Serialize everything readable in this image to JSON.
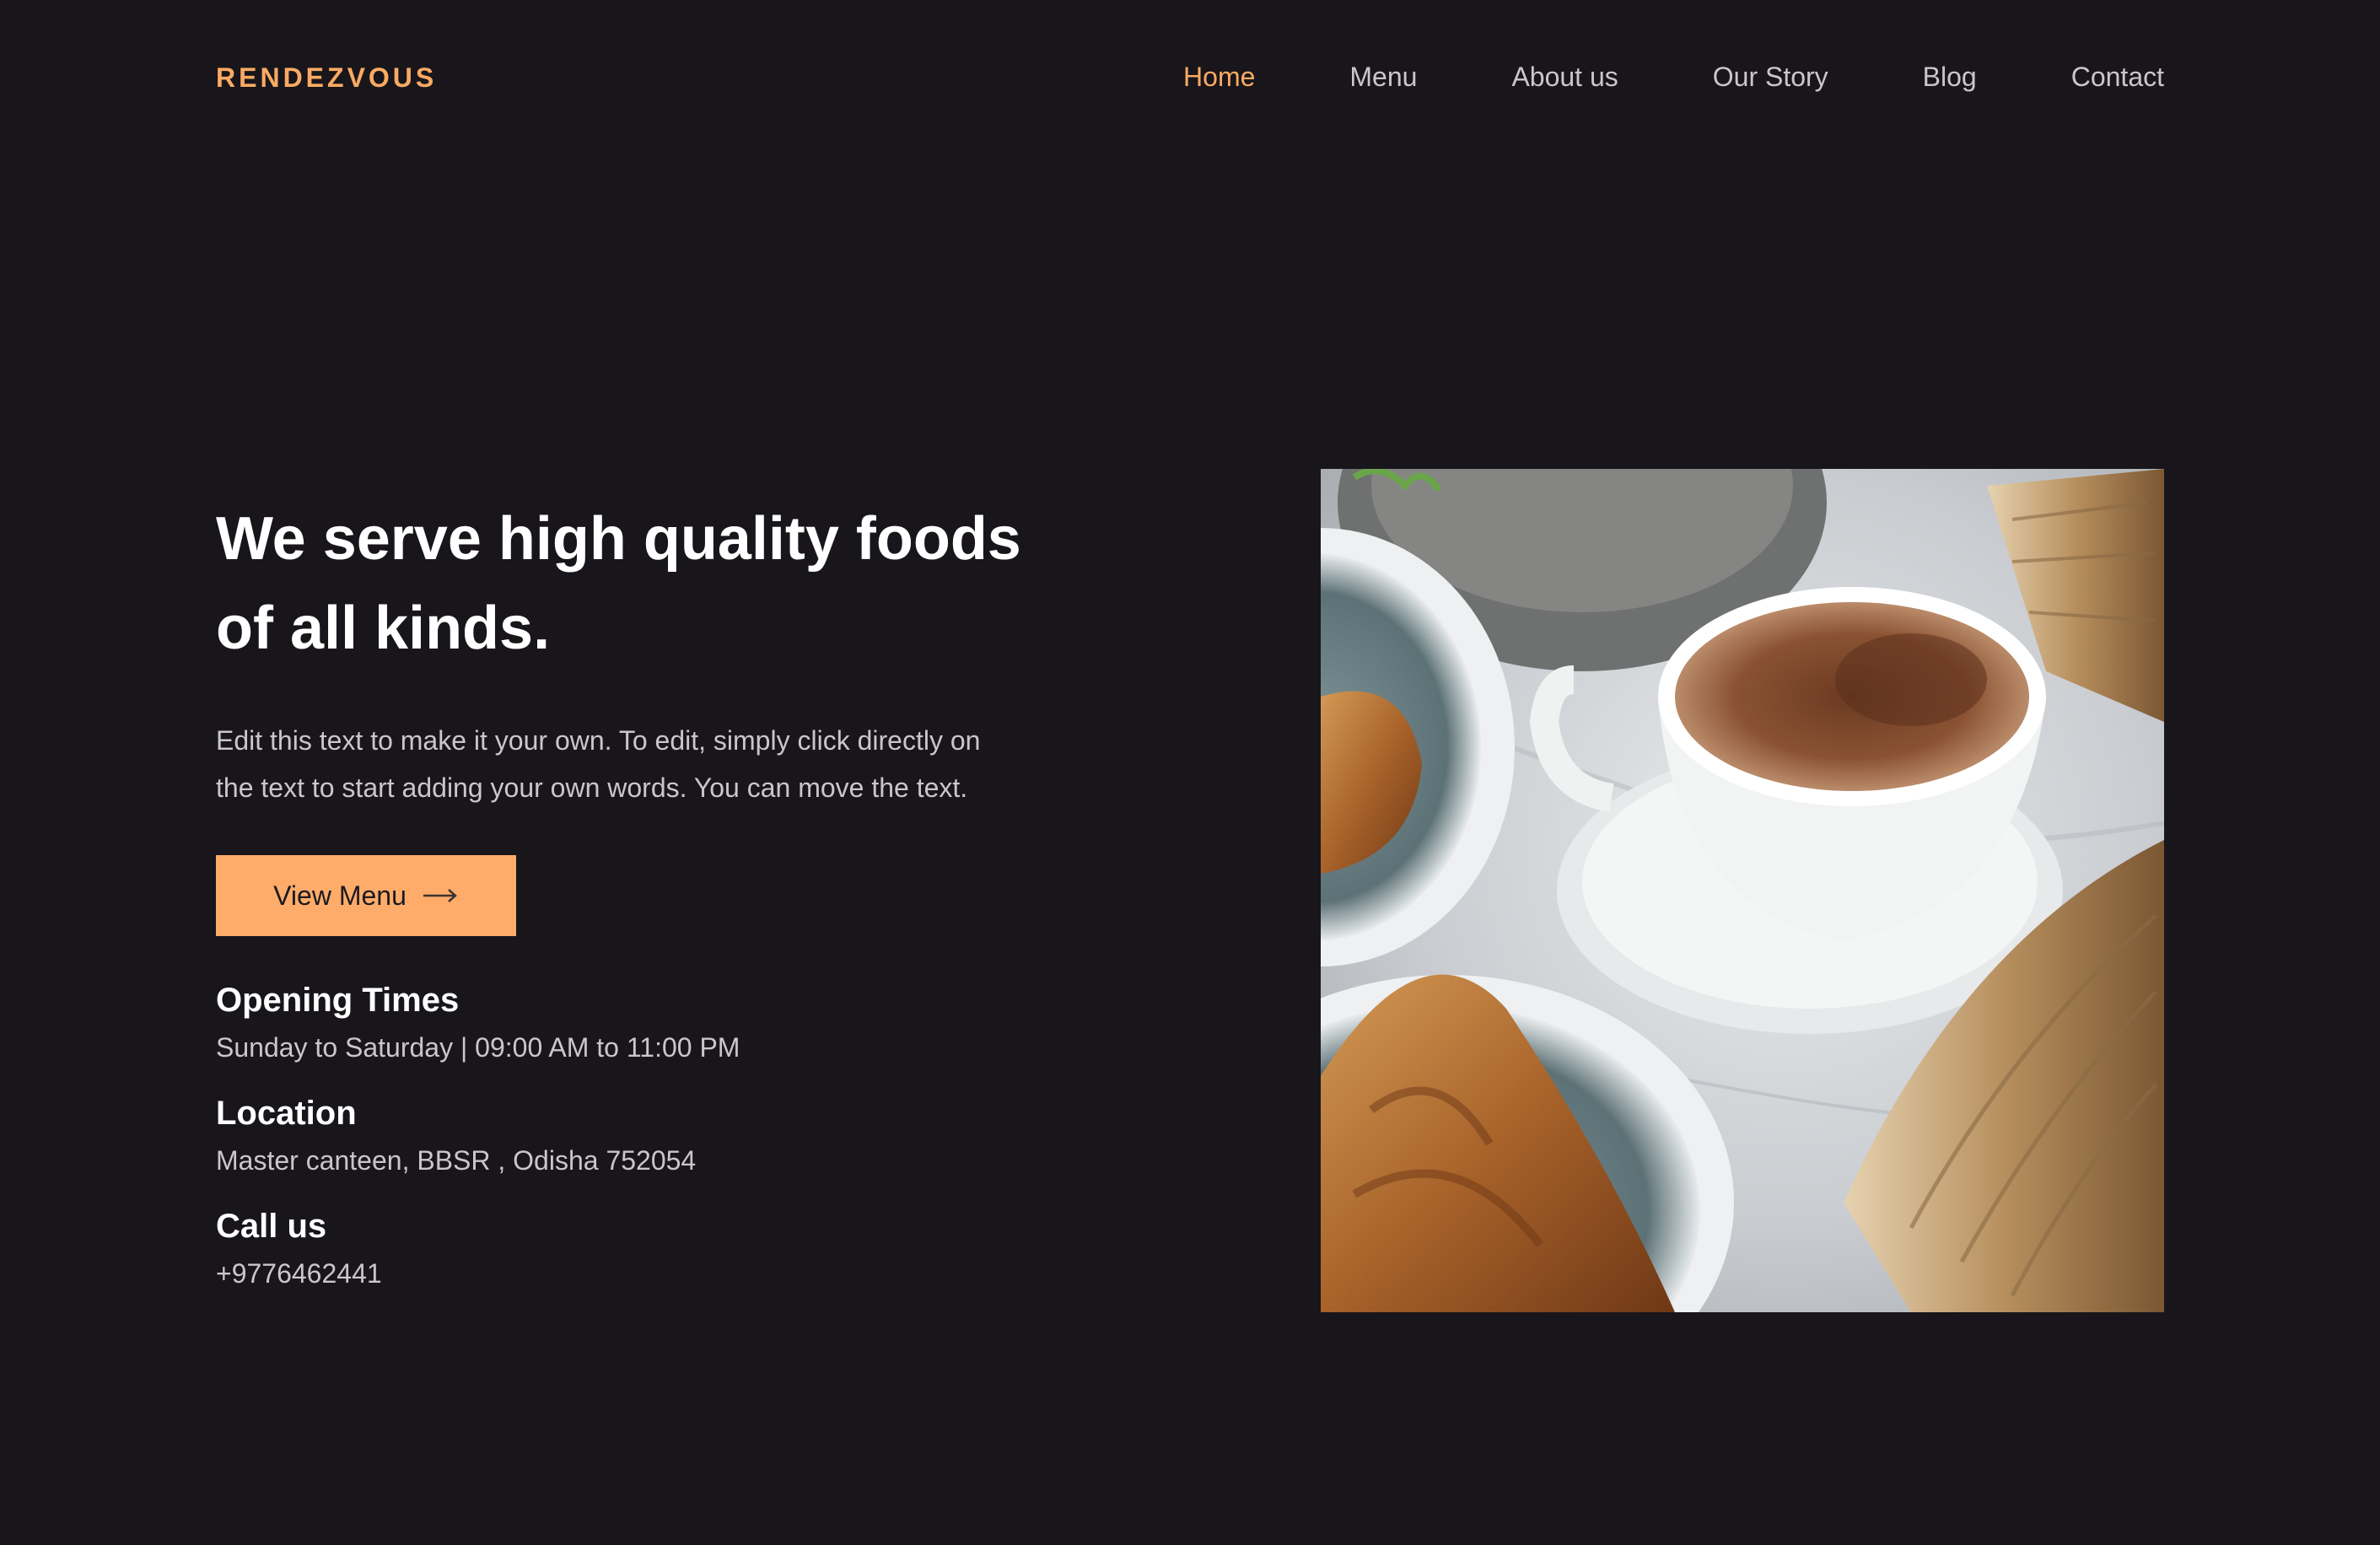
{
  "brand": {
    "name": "RENDEZVOUS",
    "color": "#fbaa63"
  },
  "nav": {
    "items": [
      {
        "label": "Home",
        "active": true
      },
      {
        "label": "Menu",
        "active": false
      },
      {
        "label": "About us",
        "active": false
      },
      {
        "label": "Our Story",
        "active": false
      },
      {
        "label": "Blog",
        "active": false
      },
      {
        "label": "Contact",
        "active": false
      }
    ]
  },
  "hero": {
    "headline_line1": "We serve high quality foods",
    "headline_line2": "of all kinds.",
    "intro_line1": "Edit this text to make it your own. To edit, simply click directly on",
    "intro_line2": "the text to start adding your own words. You can move the text.",
    "cta_label": "View Menu",
    "cta_icon": "arrow-right-icon",
    "image_icon": "coffee-and-croissant-photo"
  },
  "info": {
    "opening_title": "Opening Times",
    "opening_text": "Sunday to Saturday | 09:00 AM to 11:00 PM",
    "location_title": "Location",
    "location_text": "Master canteen, BBSR , Odisha 752054",
    "call_title": "Call us",
    "call_text": "+9776462441"
  },
  "colors": {
    "background": "#18161b",
    "accent": "#fbaa63",
    "button": "#ffac6b",
    "muted_text": "#c9c7cc"
  }
}
